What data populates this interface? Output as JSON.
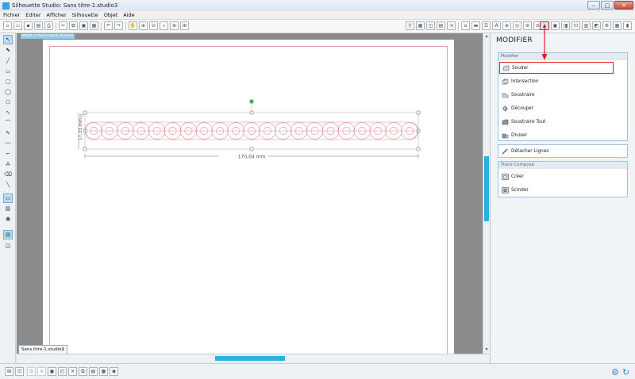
{
  "window": {
    "title": "Silhouette Studio: Sans titre-1.studio3",
    "buttons": [
      "–",
      "□",
      "✕"
    ]
  },
  "menu": [
    "Fichier",
    "Editer",
    "Afficher",
    "Silhouette",
    "Objet",
    "Aide"
  ],
  "workspace": {
    "mode_tag": "MODE D'AFFICHAGE DESIGN",
    "width_label": "170,04 mm",
    "height_label": "17,33 mm",
    "document_tab": "Sans titre-1.studio3",
    "tab_close": "x"
  },
  "panel": {
    "title": "MODIFIER",
    "modifier_header": "Modifier",
    "items": [
      {
        "label": "Souder",
        "icon": "weld-icon"
      },
      {
        "label": "Intersection",
        "icon": "intersect-icon"
      },
      {
        "label": "Soustraire",
        "icon": "subtract-icon"
      },
      {
        "label": "Découper",
        "icon": "crop-icon"
      },
      {
        "label": "Soustraire Tout",
        "icon": "subtract-all-icon"
      },
      {
        "label": "Diviser",
        "icon": "divide-icon"
      }
    ],
    "detach_label": "Détacher Lignes",
    "compound_header": "Tracé Composé",
    "compound_items": [
      {
        "label": "Créer",
        "icon": "make-compound-icon"
      },
      {
        "label": "Scinder",
        "icon": "release-compound-icon"
      }
    ]
  },
  "colors": {
    "accent": "#2cb0e0",
    "highlight": "#e0202a",
    "selection_handle": "#3bb54a"
  }
}
